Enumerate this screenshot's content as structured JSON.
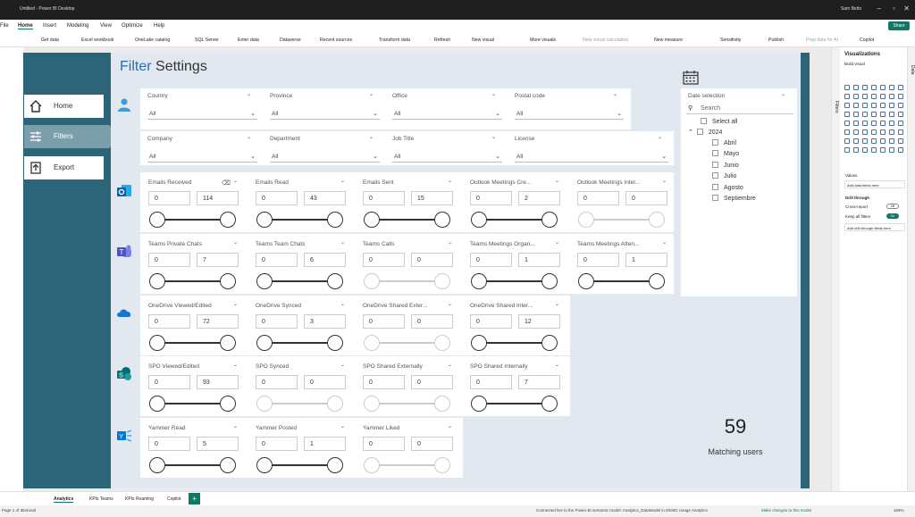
{
  "window": {
    "title": "Untitled - Power BI Desktop",
    "user": "Sam Betts"
  },
  "menu": [
    "File",
    "Home",
    "Insert",
    "Modeling",
    "View",
    "Optimize",
    "Help"
  ],
  "share_label": "Share",
  "ribbon": {
    "get_data": "Get data",
    "excel": "Excel workbook",
    "onelake": "OneLake catalog",
    "sql": "SQL Server",
    "enter_data": "Enter data",
    "dataverse": "Dataverse",
    "recent": "Recent sources",
    "transform": "Transform data",
    "refresh": "Refresh",
    "new_visual": "New visual",
    "more_visuals": "More visuals",
    "new_visual_calc": "New visual calculation",
    "new_measure": "New measure",
    "sensitivity": "Sensitivity",
    "publish": "Publish",
    "prep": "Prep data for AI",
    "copilot": "Copilot"
  },
  "page": {
    "title_accent": "Filter",
    "title_rest": "Settings"
  },
  "nav": {
    "home": "Home",
    "filters": "Filters",
    "export": "Export"
  },
  "filters": {
    "row1": [
      {
        "label": "Country",
        "value": "All"
      },
      {
        "label": "Province",
        "value": "All"
      },
      {
        "label": "Office",
        "value": "All"
      },
      {
        "label": "Postal code",
        "value": "All"
      }
    ],
    "row2": [
      {
        "label": "Company",
        "value": "All"
      },
      {
        "label": "Department",
        "value": "All"
      },
      {
        "label": "Job Title",
        "value": "All"
      },
      {
        "label": "License",
        "value": "All"
      }
    ]
  },
  "sliders": {
    "outlook": [
      {
        "label": "Emails Received",
        "min": "0",
        "max": "114",
        "active": true
      },
      {
        "label": "Emails Read",
        "min": "0",
        "max": "43",
        "active": true
      },
      {
        "label": "Emails Sent",
        "min": "0",
        "max": "15",
        "active": true
      },
      {
        "label": "Outlook Meetings Cre...",
        "min": "0",
        "max": "2",
        "active": true
      },
      {
        "label": "Outlook Meetings Inter...",
        "min": "0",
        "max": "0",
        "active": false
      }
    ],
    "teams": [
      {
        "label": "Teams Private Chats",
        "min": "0",
        "max": "7",
        "active": true
      },
      {
        "label": "Teams Team Chats",
        "min": "0",
        "max": "6",
        "active": true
      },
      {
        "label": "Teams Calls",
        "min": "0",
        "max": "0",
        "active": false
      },
      {
        "label": "Teams Meetings Organ...",
        "min": "0",
        "max": "1",
        "active": true
      },
      {
        "label": "Teams Meetings Atten...",
        "min": "0",
        "max": "1",
        "active": true
      }
    ],
    "onedrive": [
      {
        "label": "OneDrive Viewed/Edited",
        "min": "0",
        "max": "72",
        "active": true
      },
      {
        "label": "OneDrive Synced",
        "min": "0",
        "max": "3",
        "active": true
      },
      {
        "label": "OneDrive Shared Exter...",
        "min": "0",
        "max": "0",
        "active": false
      },
      {
        "label": "OneDrive Shared Inter...",
        "min": "0",
        "max": "12",
        "active": true
      }
    ],
    "spo": [
      {
        "label": "SPO Viewed/Edited",
        "min": "0",
        "max": "93",
        "active": true
      },
      {
        "label": "SPO Synced",
        "min": "0",
        "max": "0",
        "active": false
      },
      {
        "label": "SPO Shared Externally",
        "min": "0",
        "max": "0",
        "active": false
      },
      {
        "label": "SPO Shared Internally",
        "min": "0",
        "max": "7",
        "active": true
      }
    ],
    "yammer": [
      {
        "label": "Yammer Read",
        "min": "0",
        "max": "5",
        "active": true
      },
      {
        "label": "Yammer Posted",
        "min": "0",
        "max": "1",
        "active": true
      },
      {
        "label": "Yammer Liked",
        "min": "0",
        "max": "0",
        "active": false
      }
    ]
  },
  "date_selection": {
    "label": "Date selection",
    "search_placeholder": "Search",
    "select_all": "Select all",
    "year": "2024",
    "months": [
      "Abril",
      "Mayo",
      "Junio",
      "Julio",
      "Agosto",
      "Septiembre"
    ]
  },
  "matching": {
    "count": "59",
    "label": "Matching users"
  },
  "vis_pane": {
    "title": "Visualizations",
    "build": "Build visual",
    "filters_tab": "Filters",
    "data_tab": "Data",
    "values": "Values",
    "add_fields": "Add data fields here",
    "drill": "Drill through",
    "cross_report": "Cross-report",
    "keep_filters": "Keep all filters",
    "add_drill": "Add drill-through fields here",
    "toggle_off": "Off",
    "toggle_on": "On"
  },
  "tabs": [
    "Analytics",
    "KPIs Teams",
    "KPIs Roaming",
    "Copilot"
  ],
  "status": {
    "page": "Page 1 of 4",
    "sensitivity": "General",
    "connection": "Connected live to the Power BI semantic model: Analytics_DataModel in DEMO Usage Analytics",
    "make_changes": "Make changes to this model",
    "zoom": "169%"
  },
  "colors": {
    "report_bg": "#2b6577",
    "main_bg": "#e1e8ef",
    "accent": "#2b6cb0",
    "nav_active": "#7b9eab",
    "share": "#117865"
  }
}
